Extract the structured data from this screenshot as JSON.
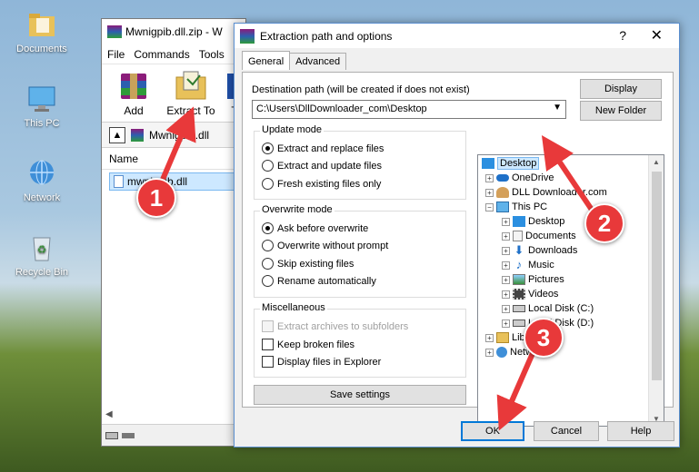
{
  "desktop": {
    "icons": [
      {
        "label": "Documents"
      },
      {
        "label": "This PC"
      },
      {
        "label": "Network"
      },
      {
        "label": "Recycle Bin"
      }
    ]
  },
  "winrar": {
    "title": "Mwnigpib.dll.zip - W",
    "menu": [
      "File",
      "Commands",
      "Tools"
    ],
    "toolbar": {
      "add": "Add",
      "extract_to": "Extract To",
      "third": "T"
    },
    "path": "Mwnigpib.dll",
    "column_name": "Name",
    "file": "mwnigpib.dll"
  },
  "dialog": {
    "title": "Extraction path and options",
    "help_glyph": "?",
    "close_glyph": "✕",
    "tabs": [
      "General",
      "Advanced"
    ],
    "destination_label": "Destination path (will be created if does not exist)",
    "destination_value": "C:\\Users\\DllDownloader_com\\Desktop",
    "display_button": "Display",
    "new_folder_button": "New Folder",
    "update_mode": {
      "title": "Update mode",
      "options": [
        "Extract and replace files",
        "Extract and update files",
        "Fresh existing files only"
      ],
      "selected": 0
    },
    "overwrite_mode": {
      "title": "Overwrite mode",
      "options": [
        "Ask before overwrite",
        "Overwrite without prompt",
        "Skip existing files",
        "Rename automatically"
      ],
      "selected": 0
    },
    "miscellaneous": {
      "title": "Miscellaneous",
      "options": [
        "Extract archives to subfolders",
        "Keep broken files",
        "Display files in Explorer"
      ]
    },
    "save_settings": "Save settings",
    "tree": [
      {
        "label": "Desktop"
      },
      {
        "label": "OneDrive"
      },
      {
        "label": "DLL Downloader.com"
      },
      {
        "label": "This PC"
      },
      {
        "label": "Desktop"
      },
      {
        "label": "Documents"
      },
      {
        "label": "Downloads"
      },
      {
        "label": "Music"
      },
      {
        "label": "Pictures"
      },
      {
        "label": "Videos"
      },
      {
        "label": "Local Disk (C:)"
      },
      {
        "label": "Local Disk (D:)"
      },
      {
        "label": "Libraries"
      },
      {
        "label": "Network"
      }
    ],
    "ok": "OK",
    "cancel": "Cancel",
    "help": "Help"
  },
  "annotations": [
    "1",
    "2",
    "3"
  ],
  "colors": {
    "accent": "#0078d7",
    "badge": "#e8393a",
    "selection": "#cde8ff"
  }
}
